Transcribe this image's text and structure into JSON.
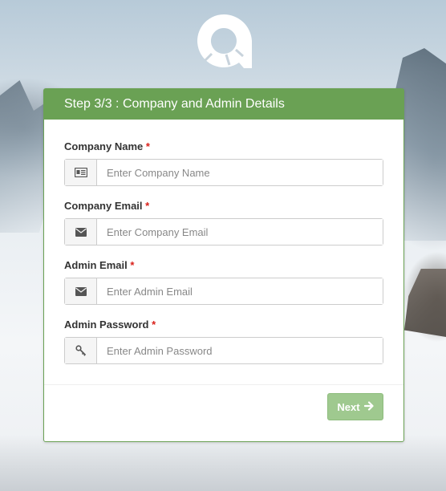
{
  "header": {
    "title": "Step 3/3 : Company and Admin Details"
  },
  "required_marker": "*",
  "fields": [
    {
      "label": "Company Name",
      "placeholder": "Enter Company Name",
      "icon": "id-card-icon",
      "value": ""
    },
    {
      "label": "Company Email",
      "placeholder": "Enter Company Email",
      "icon": "envelope-icon",
      "value": ""
    },
    {
      "label": "Admin Email",
      "placeholder": "Enter Admin Email",
      "icon": "envelope-icon",
      "value": ""
    },
    {
      "label": "Admin Password",
      "placeholder": "Enter Admin Password",
      "icon": "key-icon",
      "value": ""
    }
  ],
  "footer": {
    "next_label": "Next",
    "next_icon": "arrow-right-icon"
  },
  "colors": {
    "brand_green": "#6aa154",
    "button_disabled_green": "#9fc98f",
    "required_red": "#d9201a"
  },
  "logo": {
    "icon": "logo-icon"
  }
}
